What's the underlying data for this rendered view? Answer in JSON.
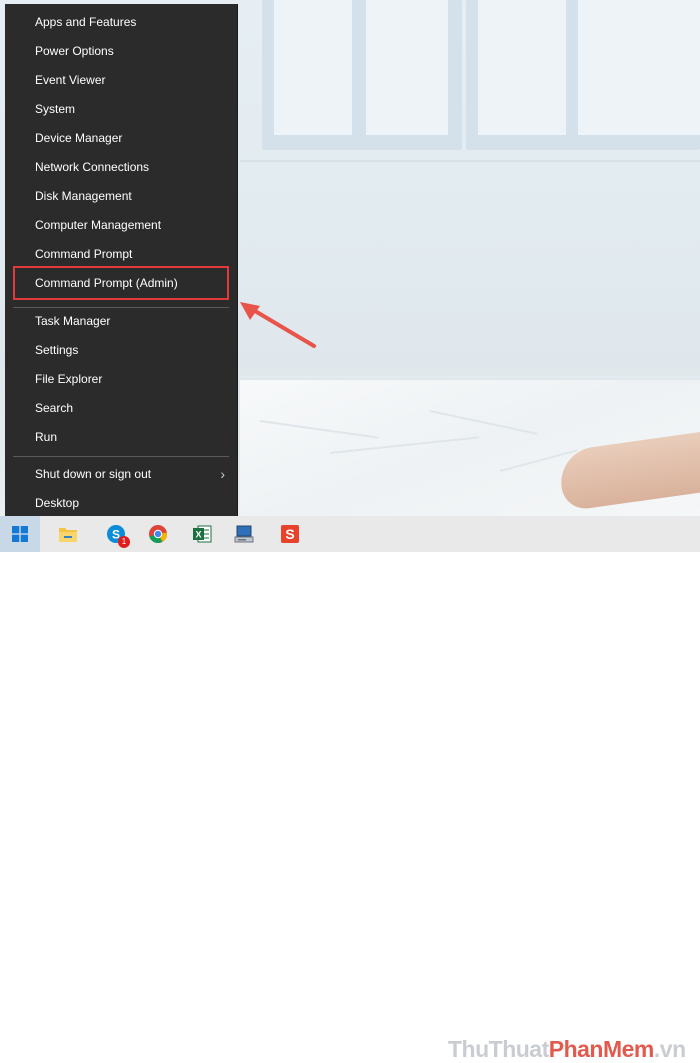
{
  "menu": {
    "items": [
      {
        "label": "Apps and Features"
      },
      {
        "label": "Power Options"
      },
      {
        "label": "Event Viewer"
      },
      {
        "label": "System"
      },
      {
        "label": "Device Manager"
      },
      {
        "label": "Network Connections"
      },
      {
        "label": "Disk Management"
      },
      {
        "label": "Computer Management"
      },
      {
        "label": "Command Prompt"
      },
      {
        "label": "Command Prompt (Admin)",
        "highlighted": true
      },
      {
        "label": "Task Manager"
      },
      {
        "label": "Settings"
      },
      {
        "label": "File Explorer"
      },
      {
        "label": "Search"
      },
      {
        "label": "Run"
      },
      {
        "label": "Shut down or sign out",
        "has_submenu": true
      },
      {
        "label": "Desktop"
      }
    ],
    "submenu_chevron": "›"
  },
  "annotation": {
    "highlight_color": "#e03a3a",
    "arrow_color": "#e8534a"
  },
  "taskbar": {
    "buttons": [
      {
        "icon": "windows-start-icon"
      },
      {
        "icon": "file-explorer-icon"
      },
      {
        "icon": "skype-icon",
        "badge": "1"
      },
      {
        "icon": "chrome-icon"
      },
      {
        "icon": "excel-icon"
      },
      {
        "icon": "computer-icon"
      },
      {
        "icon": "slides-icon"
      }
    ]
  },
  "watermark": {
    "part1": "ThuThuat",
    "part2": "PhanMem",
    "part3": ".vn"
  }
}
